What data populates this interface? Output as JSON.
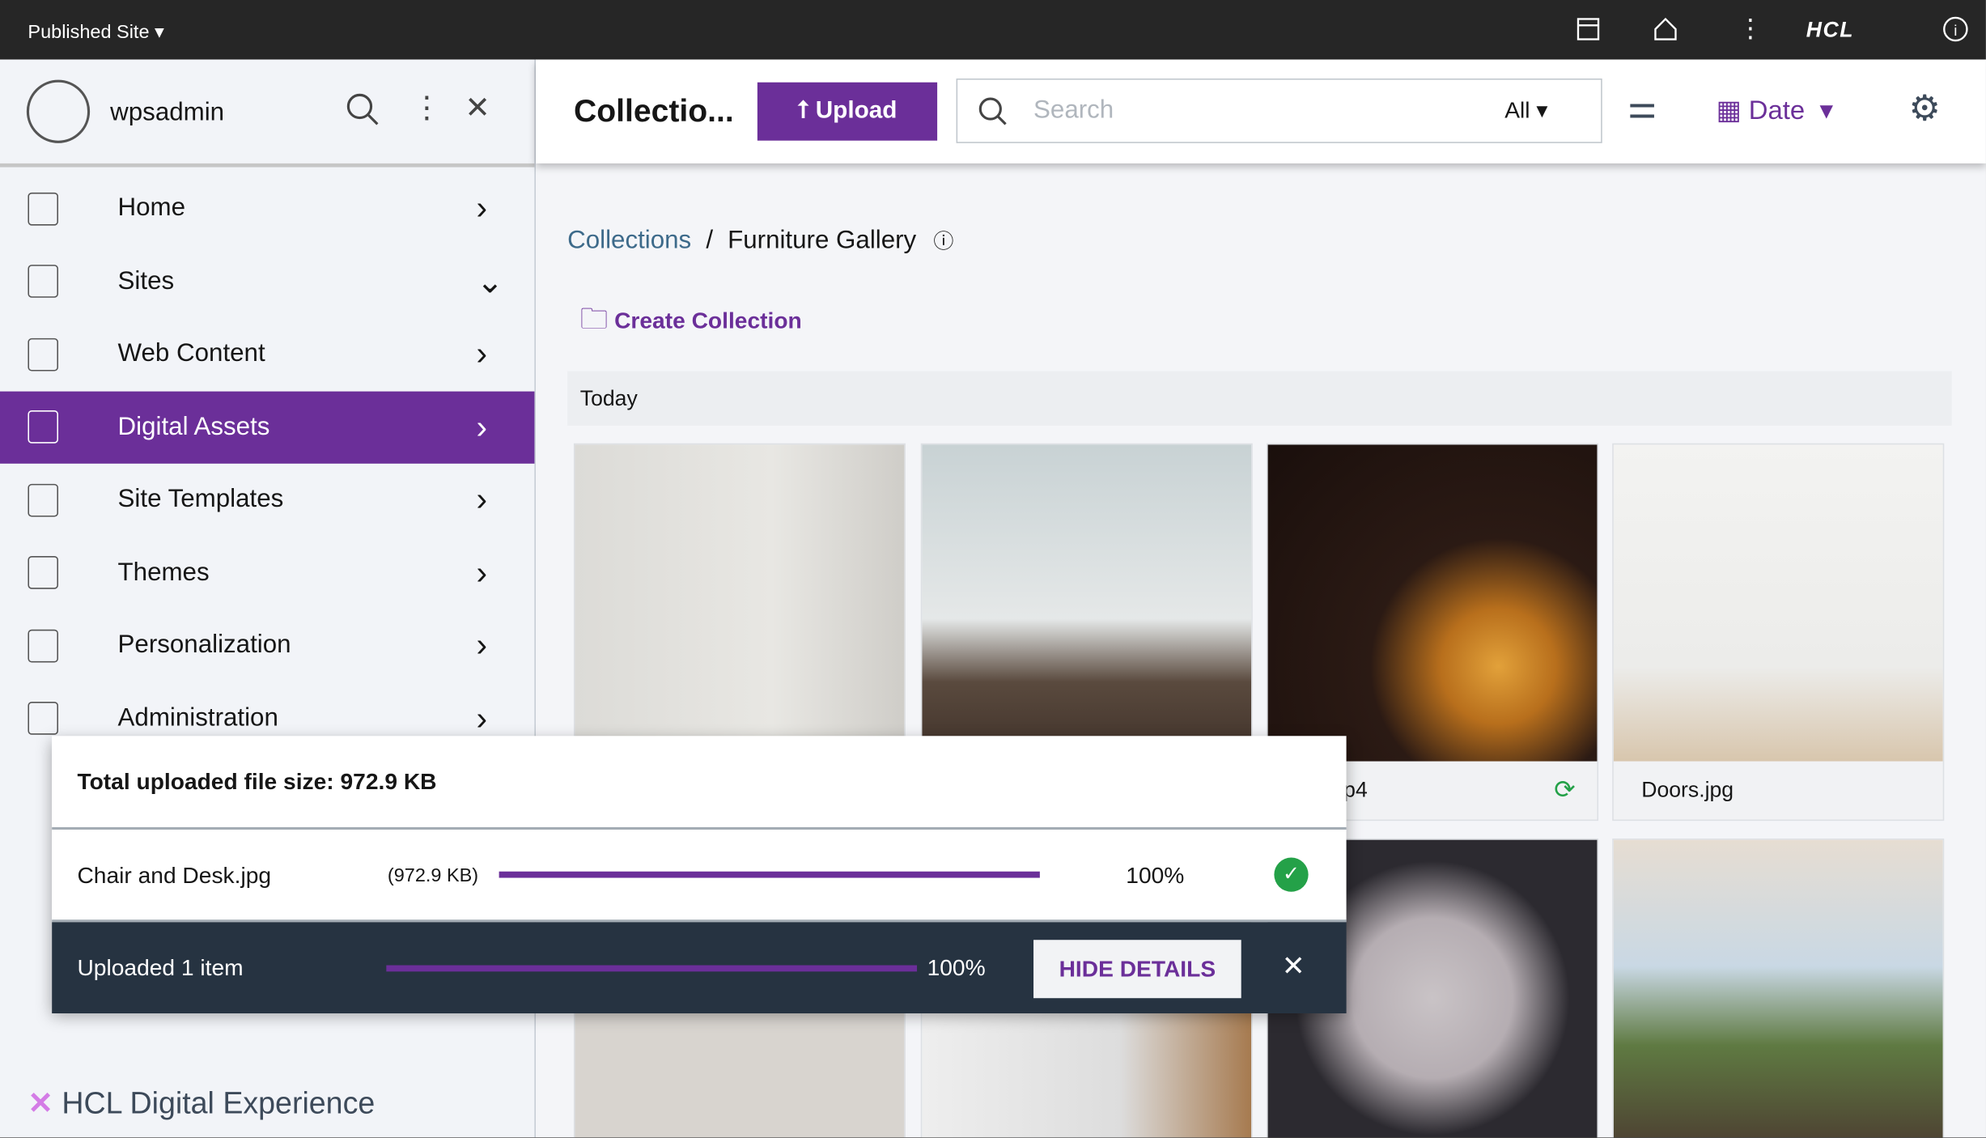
{
  "topbar": {
    "site_selector": "Published Site",
    "brand": "HCL"
  },
  "sidebar": {
    "username": "wpsadmin",
    "items": [
      {
        "label": "Home",
        "icon": "home-icon",
        "chevron": "›"
      },
      {
        "label": "Sites",
        "icon": "sites-icon",
        "chevron": "⌄"
      },
      {
        "label": "Web Content",
        "icon": "document-icon",
        "chevron": "›"
      },
      {
        "label": "Digital Assets",
        "icon": "image-icon",
        "chevron": "›",
        "active": true
      },
      {
        "label": "Site Templates",
        "icon": "template-icon",
        "chevron": "›"
      },
      {
        "label": "Themes",
        "icon": "paint-icon",
        "chevron": "›"
      },
      {
        "label": "Personalization",
        "icon": "user-icon",
        "chevron": "›"
      },
      {
        "label": "Administration",
        "icon": "clipboard-icon",
        "chevron": "›"
      }
    ],
    "footer": "HCL Digital Experience"
  },
  "toolbar": {
    "title": "Collectio...",
    "upload": "Upload",
    "search_placeholder": "Search",
    "filter": "All",
    "sort": "Date"
  },
  "breadcrumb": {
    "root": "Collections",
    "sep": "/",
    "current": "Furniture Gallery"
  },
  "create_collection": "Create Collection",
  "group": "Today",
  "cards": [
    {
      "caption": ""
    },
    {
      "caption": ""
    },
    {
      "caption": "ee.mp4"
    },
    {
      "caption": "Doors.jpg"
    }
  ],
  "upload_panel": {
    "total": "Total uploaded file size: 972.9 KB",
    "file": {
      "name": "Chair and Desk.jpg",
      "size": "(972.9 KB)",
      "progress": "100%"
    },
    "summary": "Uploaded 1 item",
    "overall": "100%",
    "hide": "HIDE DETAILS"
  },
  "colors": {
    "accent": "#6b2f99",
    "success": "#24a148",
    "footer": "#263341"
  }
}
